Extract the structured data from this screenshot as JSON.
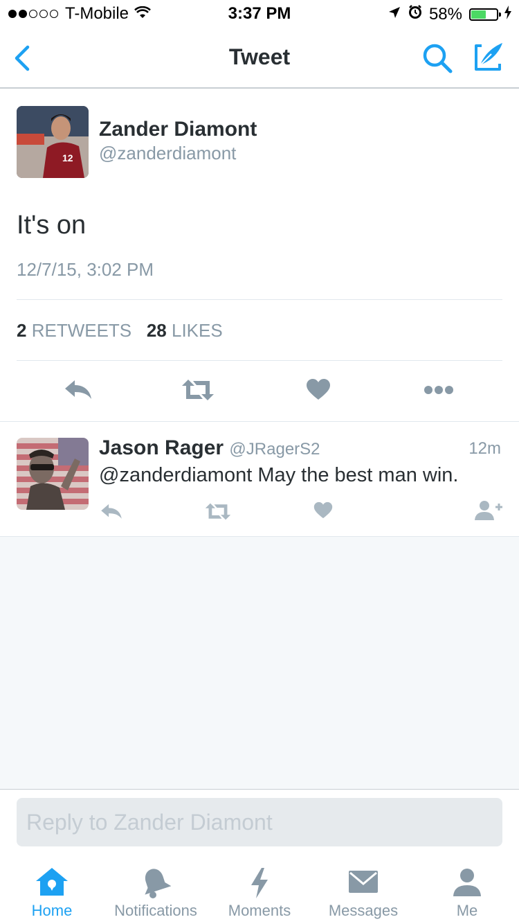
{
  "status_bar": {
    "carrier": "T-Mobile",
    "time": "3:37 PM",
    "battery": "58%",
    "battery_level": 0.58
  },
  "nav": {
    "title": "Tweet"
  },
  "tweet": {
    "author_name": "Zander Diamont",
    "author_handle": "@zanderdiamont",
    "text": "It's on",
    "timestamp": "12/7/15, 3:02 PM",
    "retweet_count": "2",
    "retweet_label": "RETWEETS",
    "like_count": "28",
    "like_label": "LIKES"
  },
  "reply": {
    "author_name": "Jason Rager",
    "author_handle": "@JRagerS2",
    "time_ago": "12m",
    "text": "@zanderdiamont May the best man win."
  },
  "composer": {
    "placeholder": "Reply to Zander Diamont"
  },
  "tabs": [
    {
      "label": "Home",
      "icon": "home-icon"
    },
    {
      "label": "Notifications",
      "icon": "bell-icon"
    },
    {
      "label": "Moments",
      "icon": "lightning-icon"
    },
    {
      "label": "Messages",
      "icon": "envelope-icon"
    },
    {
      "label": "Me",
      "icon": "person-icon"
    }
  ],
  "colors": {
    "accent": "#1da1f2",
    "muted": "#8899a6",
    "text": "#292f33",
    "battery_fill": "#4cd964"
  }
}
